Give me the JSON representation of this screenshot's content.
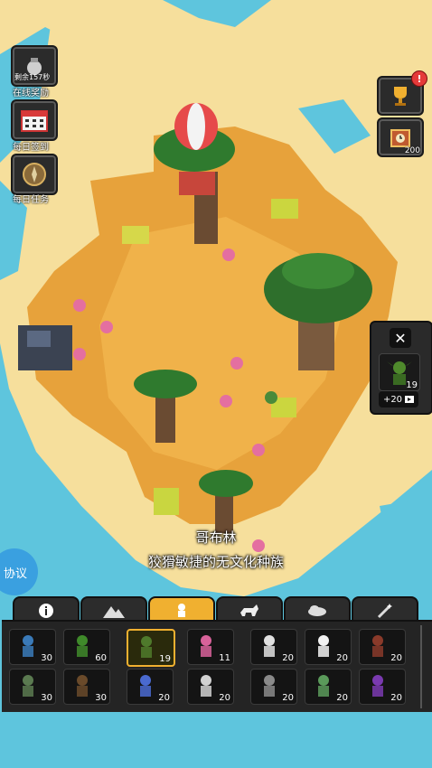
{
  "side_buttons": [
    {
      "icon": "pouch-icon",
      "caption": "剩余157秒",
      "label": "在线奖励"
    },
    {
      "icon": "calendar-icon",
      "caption": "",
      "label": "每日签到"
    },
    {
      "icon": "compass-icon",
      "caption": "",
      "label": "每日任务"
    }
  ],
  "right_buttons": [
    {
      "icon": "trophy-icon",
      "badge": "!",
      "count": ""
    },
    {
      "icon": "clock-chest-icon",
      "badge": "",
      "count": "200"
    }
  ],
  "selected_unit": {
    "close_label": "✕",
    "icon": "goblin-icon",
    "count": "19",
    "plus_label": "+20"
  },
  "caption": {
    "title": "哥布林",
    "description": "狡猾敏捷的无文化种族"
  },
  "protocol_label": "协议",
  "tabs": [
    {
      "icon": "info-icon",
      "active": false
    },
    {
      "icon": "mountain-icon",
      "active": false
    },
    {
      "icon": "creature-icon",
      "active": true
    },
    {
      "icon": "wolf-icon",
      "active": false
    },
    {
      "icon": "cloud-icon",
      "active": false
    },
    {
      "icon": "magic-wand-icon",
      "active": false
    }
  ],
  "units": [
    {
      "name": "human-icon",
      "count": "30",
      "color": "#3a7ab8"
    },
    {
      "name": "elf-icon",
      "count": "60",
      "color": "#3f8a2a"
    },
    {
      "name": "goblin-icon",
      "count": "19",
      "color": "#4f7a2c",
      "active": true
    },
    {
      "name": "fairy-icon",
      "count": "11",
      "color": "#d8629a"
    },
    {
      "name": "skeleton-icon",
      "count": "20",
      "color": "#e0e0e0"
    },
    {
      "name": "ghost-icon",
      "count": "20",
      "color": "#f2f2f2"
    },
    {
      "name": "bandit-icon",
      "count": "20",
      "color": "#8a3a2a"
    },
    {
      "name": "orc-icon",
      "count": "30",
      "color": "#5a7a50"
    },
    {
      "name": "dwarf-icon",
      "count": "30",
      "color": "#6a4a2a"
    },
    {
      "name": "lizardman-icon",
      "count": "20",
      "color": "#4a6ad0"
    },
    {
      "name": "wizard-icon",
      "count": "20",
      "color": "#d0d0d0"
    },
    {
      "name": "rock-golem-icon",
      "count": "20",
      "color": "#8a8a8a"
    },
    {
      "name": "zombie-icon",
      "count": "20",
      "color": "#5a9a5a"
    },
    {
      "name": "necromancer-icon",
      "count": "20",
      "color": "#7a3ab0"
    }
  ]
}
